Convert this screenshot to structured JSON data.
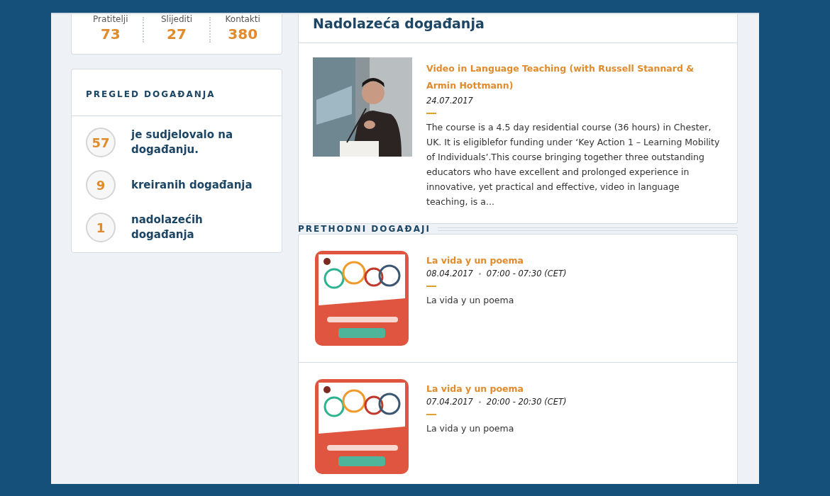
{
  "stats": [
    {
      "label": "Pratitelji",
      "value": "73"
    },
    {
      "label": "Slijediti",
      "value": "27"
    },
    {
      "label": "Kontakti",
      "value": "380"
    }
  ],
  "overview": {
    "title": "PREGLED DOGAĐANJA",
    "items": [
      {
        "count": "57",
        "label": "je sudjelovalo na događanju."
      },
      {
        "count": "9",
        "label": "kreiranih događanja"
      },
      {
        "count": "1",
        "label": "nadolazećih događanja"
      }
    ]
  },
  "upcoming": {
    "title": "Nadolazeća događanja",
    "events": [
      {
        "title": "Video in Language Teaching (with Russell Stannard & Armin Hottmann)",
        "date": "24.07.2017",
        "description": "The course is a 4.5 day residential course (36 hours) in Chester, UK. It is eligiblefor funding under ‘Key Action 1 – Learning Mobility of Individuals’.This course bringing together three outstanding educators who have excellent and prolonged experience in innovative, yet practical and effective, video in language teaching, is a..."
      }
    ]
  },
  "past": {
    "title": "PRETHODNI DOGAĐAJI",
    "events": [
      {
        "title": "La vida y un poema",
        "date": "08.04.2017",
        "time": "07:00 - 07:30 (CET)",
        "description": "La vida y un poema"
      },
      {
        "title": "La vida y un poema",
        "date": "07.04.2017",
        "time": "20:00 - 20:30 (CET)",
        "description": "La vida y un poema"
      }
    ]
  }
}
